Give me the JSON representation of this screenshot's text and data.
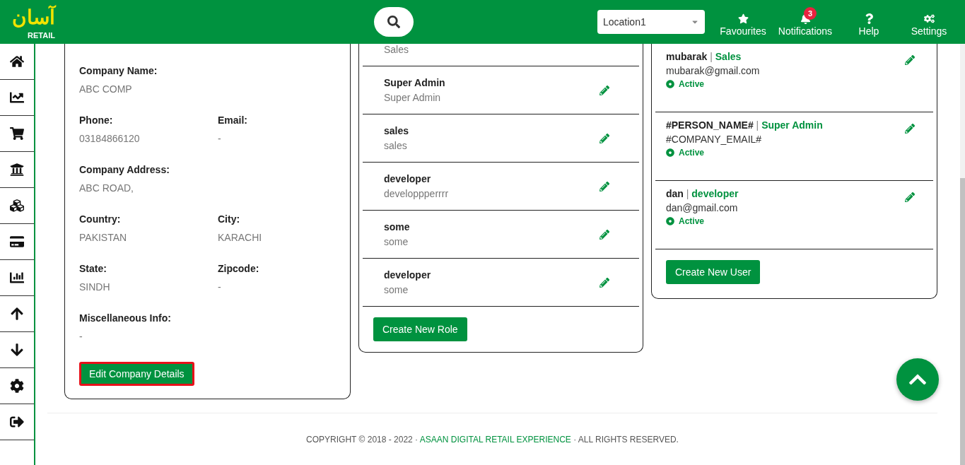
{
  "header": {
    "logo": {
      "script": "آسان",
      "word": "RETAIL"
    },
    "location": {
      "value": "Location1"
    },
    "nav": [
      {
        "label": "Favourites",
        "kind": "star"
      },
      {
        "label": "Notifications",
        "kind": "bell",
        "badge": "3"
      },
      {
        "label": "Help",
        "kind": "help"
      },
      {
        "label": "Settings",
        "kind": "settings"
      }
    ]
  },
  "sidebar": {
    "items": [
      {
        "kind": "home"
      },
      {
        "kind": "trend"
      },
      {
        "kind": "cart"
      },
      {
        "kind": "bank"
      },
      {
        "kind": "cubes"
      },
      {
        "kind": "card"
      },
      {
        "kind": "bars"
      },
      {
        "kind": "up"
      },
      {
        "kind": "down"
      },
      {
        "kind": "gear"
      },
      {
        "kind": "logout"
      }
    ]
  },
  "company": {
    "fields": [
      [
        {
          "label": "Company Name:",
          "value": "ABC COMP"
        }
      ],
      [
        {
          "label": "Phone:",
          "value": "03184866120"
        },
        {
          "label": "Email:",
          "value": "-"
        }
      ],
      [
        {
          "label": "Company Address:",
          "value": "ABC ROAD,"
        }
      ],
      [
        {
          "label": "Country:",
          "value": "PAKISTAN"
        },
        {
          "label": "City:",
          "value": "KARACHI"
        }
      ],
      [
        {
          "label": "State:",
          "value": "SINDH"
        },
        {
          "label": "Zipcode:",
          "value": "-"
        }
      ],
      [
        {
          "label": "Miscellaneous Info:",
          "value": "-"
        }
      ]
    ],
    "button": {
      "label": "Edit Company Details",
      "focused": true
    }
  },
  "roles": {
    "items": [
      {
        "description": "Sales"
      },
      {
        "title": "Super Admin",
        "description": "Super Admin"
      },
      {
        "title": "sales",
        "description": "sales"
      },
      {
        "title": "developer",
        "description": "developpperrrr"
      },
      {
        "title": "some",
        "description": "some"
      },
      {
        "title": "developer",
        "description": "some"
      }
    ],
    "button": "Create New Role"
  },
  "users": {
    "items": [
      {
        "name": "mubarak",
        "separator": "|",
        "role": "Sales",
        "email": "mubarak@gmail.com",
        "status": "Active",
        "active": true
      },
      {
        "name": "#PERSON_NAME#",
        "separator": "|",
        "role": "Super Admin",
        "email": "#COMPANY_EMAIL#",
        "status": "Active",
        "active": true
      },
      {
        "name": "dan",
        "separator": "|",
        "role": "developer",
        "email": "dan@gmail.com",
        "status": "Active",
        "active": true
      }
    ],
    "button": "Create New User"
  },
  "footer": {
    "prefix": "COPYRIGHT © 2018 - 2022 · ",
    "link": "ASAAN DIGITAL RETAIL EXPERIENCE",
    "suffix": " · ALL RIGHTS RESERVED."
  }
}
